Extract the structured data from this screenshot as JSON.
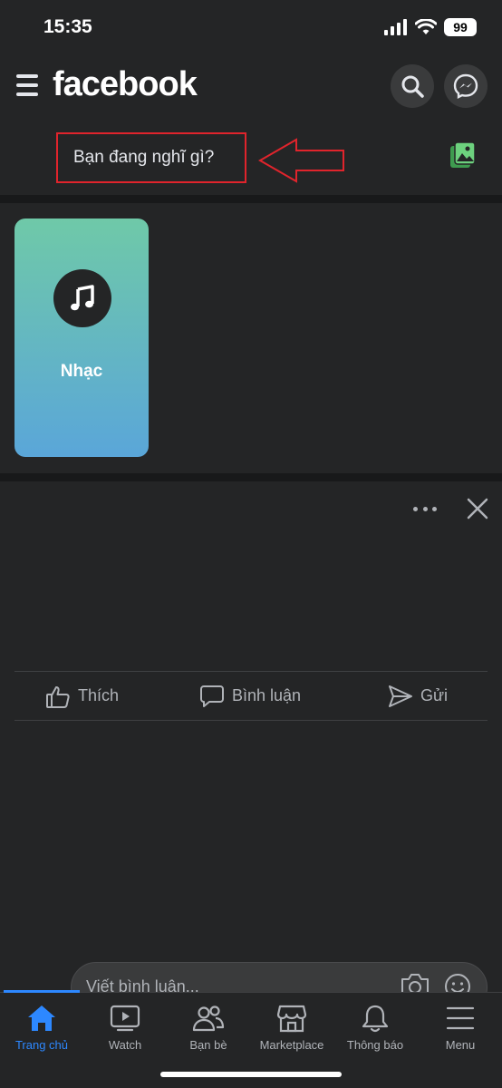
{
  "status_bar": {
    "time": "15:35",
    "battery": "99"
  },
  "header": {
    "brand": "facebook"
  },
  "composer": {
    "placeholder": "Bạn đang nghĩ gì?"
  },
  "music_card": {
    "label": "Nhạc"
  },
  "post_actions": {
    "like": "Thích",
    "comment": "Bình luận",
    "send": "Gửi"
  },
  "comment_input": {
    "placeholder": "Viết bình luận..."
  },
  "bottom_nav": {
    "items": [
      {
        "label": "Trang chủ",
        "active": true
      },
      {
        "label": "Watch"
      },
      {
        "label": "Bạn bè"
      },
      {
        "label": "Marketplace"
      },
      {
        "label": "Thông báo"
      },
      {
        "label": "Menu"
      }
    ]
  },
  "colors": {
    "background": "#242526",
    "accent": "#2d88ff",
    "highlight_box": "#e0242c"
  },
  "icons": [
    "hamburger-icon",
    "search-icon",
    "messenger-icon",
    "photo-icon",
    "music-note-icon",
    "more-icon",
    "close-icon",
    "like-icon",
    "comment-icon",
    "send-icon",
    "camera-icon",
    "smile-icon",
    "home-icon",
    "watch-icon",
    "friends-icon",
    "marketplace-icon",
    "bell-icon",
    "menu-icon"
  ]
}
